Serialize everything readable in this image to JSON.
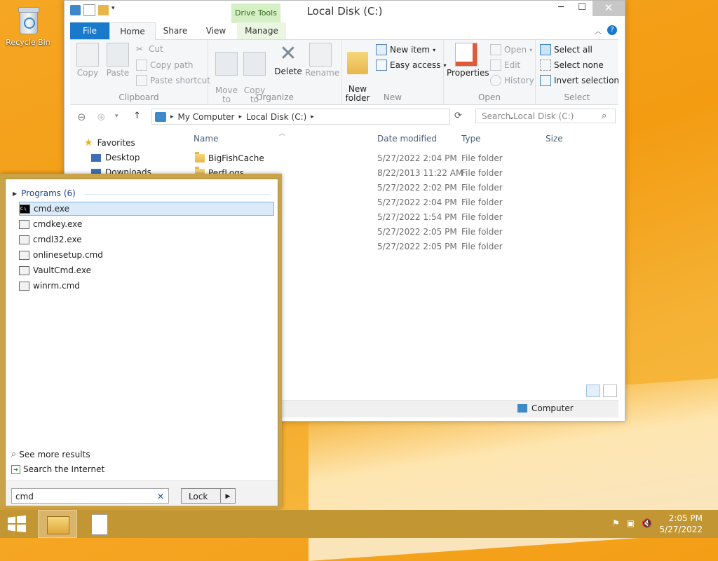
{
  "desktop": {
    "recycle_bin_label": "Recycle Bin"
  },
  "explorer": {
    "title": "Local Disk (C:)",
    "contextual_tab": "Drive Tools",
    "tabs": [
      "File",
      "Home",
      "Share",
      "View",
      "Manage"
    ],
    "ribbon": {
      "clipboard": {
        "label": "Clipboard",
        "copy": "Copy",
        "paste": "Paste",
        "cut": "Cut",
        "copy_path": "Copy path",
        "paste_shortcut": "Paste shortcut"
      },
      "organize": {
        "label": "Organize",
        "move_to": "Move\nto",
        "copy_to": "Copy\nto",
        "delete": "Delete",
        "rename": "Rename"
      },
      "new": {
        "label": "New",
        "new_folder": "New\nfolder",
        "new_item": "New item",
        "easy_access": "Easy access"
      },
      "open": {
        "label": "Open",
        "properties": "Properties",
        "open": "Open",
        "edit": "Edit",
        "history": "History"
      },
      "select": {
        "label": "Select",
        "select_all": "Select all",
        "select_none": "Select none",
        "invert_selection": "Invert selection"
      }
    },
    "address": {
      "segments": [
        "My Computer",
        "Local Disk (C:)"
      ]
    },
    "search_placeholder": "Search Local Disk (C:)",
    "nav": {
      "favorites": "Favorites",
      "desktop": "Desktop",
      "downloads": "Downloads"
    },
    "columns": {
      "name": "Name",
      "date": "Date modified",
      "type": "Type",
      "size": "Size"
    },
    "rows": [
      {
        "name": "BigFishCache",
        "date": "5/27/2022 2:04 PM",
        "type": "File folder"
      },
      {
        "name": "PerfLogs",
        "date": "8/22/2013 11:22 AM",
        "type": "File folder"
      },
      {
        "name": "",
        "date": "5/27/2022 2:02 PM",
        "type": "File folder"
      },
      {
        "name": "",
        "date": "5/27/2022 2:04 PM",
        "type": "File folder"
      },
      {
        "name": "",
        "date": "5/27/2022 1:54 PM",
        "type": "File folder"
      },
      {
        "name": "",
        "date": "5/27/2022 2:05 PM",
        "type": "File folder"
      },
      {
        "name": "",
        "date": "5/27/2022 2:05 PM",
        "type": "File folder"
      }
    ],
    "status_location": "Computer"
  },
  "search_popup": {
    "programs_header": "Programs (6)",
    "results": [
      "cmd.exe",
      "cmdkey.exe",
      "cmdl32.exe",
      "onlinesetup.cmd",
      "VaultCmd.exe",
      "winrm.cmd"
    ],
    "see_more": "See more results",
    "search_internet": "Search the Internet",
    "query": "cmd",
    "lock_label": "Lock"
  },
  "taskbar": {
    "time": "2:05 PM",
    "date": "5/27/2022"
  },
  "colors": {
    "accent": "#1979ca",
    "taskbar": "#c29632",
    "wallpaper": "#f39c12"
  }
}
